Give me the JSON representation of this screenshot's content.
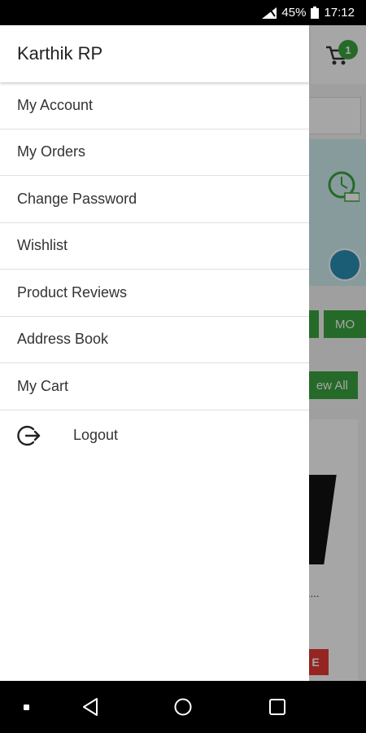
{
  "status_bar": {
    "battery_percent": "45%",
    "time": "17:12"
  },
  "background": {
    "cart_count": "1",
    "button_1": "",
    "button_2": "MO",
    "view_all": "ew All",
    "product_dots": "....",
    "sale_label": "E"
  },
  "drawer": {
    "user_name": "Karthik RP",
    "items": [
      {
        "label": "My Account"
      },
      {
        "label": "My Orders"
      },
      {
        "label": "Change Password"
      },
      {
        "label": "Wishlist"
      },
      {
        "label": "Product Reviews"
      },
      {
        "label": "Address Book"
      },
      {
        "label": "My Cart"
      }
    ],
    "logout_label": "Logout"
  },
  "colors": {
    "accent": "#3aa33f",
    "sale": "#e53935"
  }
}
